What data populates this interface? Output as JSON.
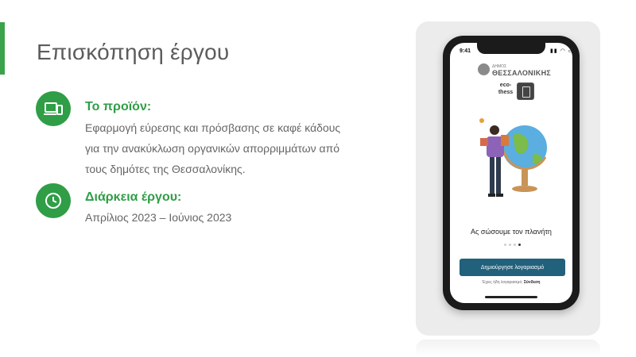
{
  "slide": {
    "title": "Επισκόπηση έργου"
  },
  "product": {
    "heading": "Το προϊόν:",
    "lines": [
      "Εφαρμογή εύρεσης και πρόσβασης σε καφέ κάδους",
      "για την ανακύκλωση οργανικών απορριμμάτων από",
      "τους δημότες της Θεσσαλονίκης."
    ],
    "icon": "devices-icon"
  },
  "duration": {
    "heading": "Διάρκεια έργου:",
    "text": "Απρίλιος 2023 – Ιούνιος 2023",
    "icon": "clock-icon"
  },
  "phone": {
    "status_time": "9:41",
    "logo_small": "ΔΗΜΟΣ",
    "logo_big": "ΘΕΣΣΑΛΟΝΙΚΗΣ",
    "app_name_line1": "eco-",
    "app_name_line2": "thess",
    "tagline": "Ας σώσουμε τον πλανήτη",
    "cta_label": "Δημιούργησε λογαριασμό",
    "login_prompt": "Έχεις ήδη λογαριασμό;",
    "login_link": "Σύνδεση",
    "carousel_active_index": 3,
    "carousel_count": 4
  },
  "colors": {
    "accent_green": "#2f9e46",
    "cta_blue": "#22617c"
  }
}
